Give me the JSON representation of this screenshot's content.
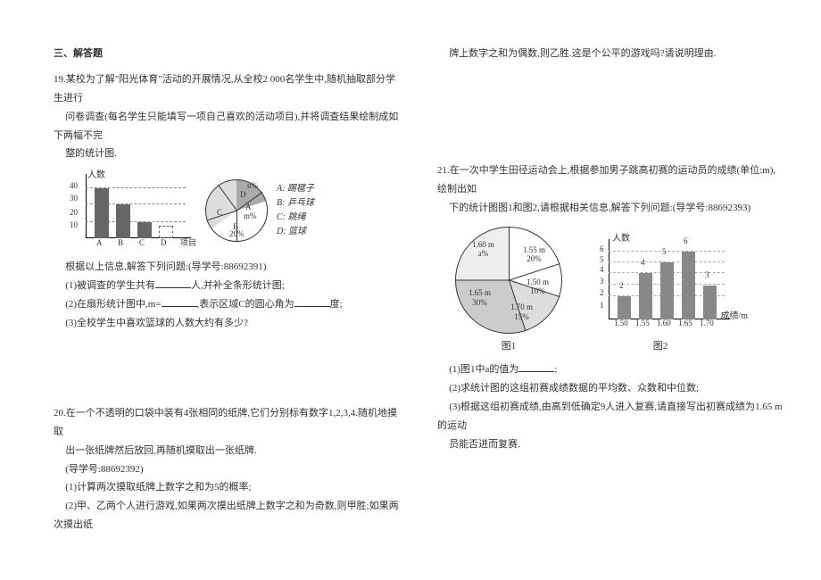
{
  "section": {
    "title": "三、解答题"
  },
  "q19": {
    "stem1": "19.某校为了解\"阳光体育\"活动的开展情况,从全校2 000名学生中,随机抽取部分学生进行",
    "stem2": "问卷调查(每名学生只能填写一项自己喜欢的活动项目),并将调查结果绘制成如下两幅不完",
    "stem3": "整的统计图.",
    "bar_ylabel": "人数",
    "bar_ticks": [
      "10",
      "20",
      "30",
      "40"
    ],
    "bar_x": [
      "A",
      "B",
      "C",
      "D"
    ],
    "bar_axis_x": "项目",
    "pie_label_C": "C",
    "pie_label_D": "D",
    "pie_label_A": "A",
    "pie_label_m": "m%",
    "pie_label_n": "n%",
    "pie_label_B": "B",
    "pie_label_20": "20%",
    "legend_A": "A: 踢毽子",
    "legend_B": "B: 乒乓球",
    "legend_C": "C: 跳绳",
    "legend_D": "D: 篮球",
    "prompt": "根据以上信息,解答下列问题:(导学号:88692391)",
    "a": "(1)被调查的学生共有",
    "a_suffix": "人,并补全条形统计图;",
    "b": "(2)在扇形统计图中,m=",
    "b_mid": ",表示区域C的圆心角为",
    "b_suffix": "度;",
    "c": "(3)全校学生中喜欢篮球的人数大约有多少?"
  },
  "q20": {
    "stem1": "20.在一个不透明的口袋中装有4张相同的纸牌,它们分别标有数字1,2,3,4.随机地摸取",
    "stem2": "出一张纸牌然后放回,再随机摸取出一张纸牌.",
    "hint": "(导学号:88692392)",
    "a": "(1)计算两次摸取纸牌上数字之和为5的概率;",
    "b": "(2)甲、乙两个人进行游戏,如果两次摸出纸牌上数字之和为奇数,则甲胜;如果两次摸出纸"
  },
  "q20_cont": "牌上数字之和为偶数,则乙胜.这是个公平的游戏吗?请说明理由.",
  "q21": {
    "stem1": "21.在一次中学生田径运动会上,根据参加男子跳高初赛的运动员的成绩(单位:m),绘制出如",
    "stem2": "下的统计图图1和图2,请根据相关信息,解答下列问题:(导学号:88692393)",
    "pie": {
      "s1_55": "1.55 m",
      "p1_55": "20%",
      "s1_50": "1.50 m",
      "p1_50": "10%",
      "s1_70": "1.70 m",
      "p1_70": "15%",
      "s1_65": "1.65 m",
      "p1_65": "30%",
      "s1_60": "1.60 m",
      "p1_60": "a%"
    },
    "bar": {
      "ylabel": "人数",
      "xlabel": "成绩/m",
      "vals": [
        "2",
        "4",
        "5",
        "6",
        "3"
      ],
      "xs": [
        "1.50",
        "1.55",
        "1.60",
        "1.65",
        "1.70"
      ]
    },
    "cap1": "图1",
    "cap2": "图2",
    "a": "(1)图1中a的值为",
    "a_suffix": ";",
    "b": "(2)求统计图的这组初赛成绩数据的平均数、众数和中位数;",
    "c1": "(3)根据这组初赛成绩,由高到低确定9人进入复赛,请直接写出初赛成绩为1.65 m的运动",
    "c2": "员能否进而复赛."
  },
  "chart_data": [
    {
      "type": "bar",
      "title": "Q19 条形统计图",
      "categories": [
        "A",
        "B",
        "C",
        "D"
      ],
      "values": [
        30,
        20,
        10,
        null
      ],
      "ylabel": "人数",
      "xlabel": "项目",
      "ylim": [
        0,
        40
      ]
    },
    {
      "type": "pie",
      "title": "Q19 扇形统计图",
      "series": [
        {
          "name": "A",
          "label": "m%",
          "value": null
        },
        {
          "name": "B",
          "label": "20%",
          "value": 20
        },
        {
          "name": "C",
          "label": null,
          "value": null
        },
        {
          "name": "D",
          "label": "n%",
          "value": null
        }
      ]
    },
    {
      "type": "pie",
      "title": "Q21 图1",
      "series": [
        {
          "name": "1.50 m",
          "value": 10
        },
        {
          "name": "1.55 m",
          "value": 20
        },
        {
          "name": "1.60 m",
          "value": null,
          "label": "a%"
        },
        {
          "name": "1.65 m",
          "value": 30
        },
        {
          "name": "1.70 m",
          "value": 15
        }
      ]
    },
    {
      "type": "bar",
      "title": "Q21 图2",
      "categories": [
        "1.50",
        "1.55",
        "1.60",
        "1.65",
        "1.70"
      ],
      "values": [
        2,
        4,
        5,
        6,
        3
      ],
      "ylabel": "人数",
      "xlabel": "成绩/m",
      "ylim": [
        0,
        7
      ]
    }
  ]
}
